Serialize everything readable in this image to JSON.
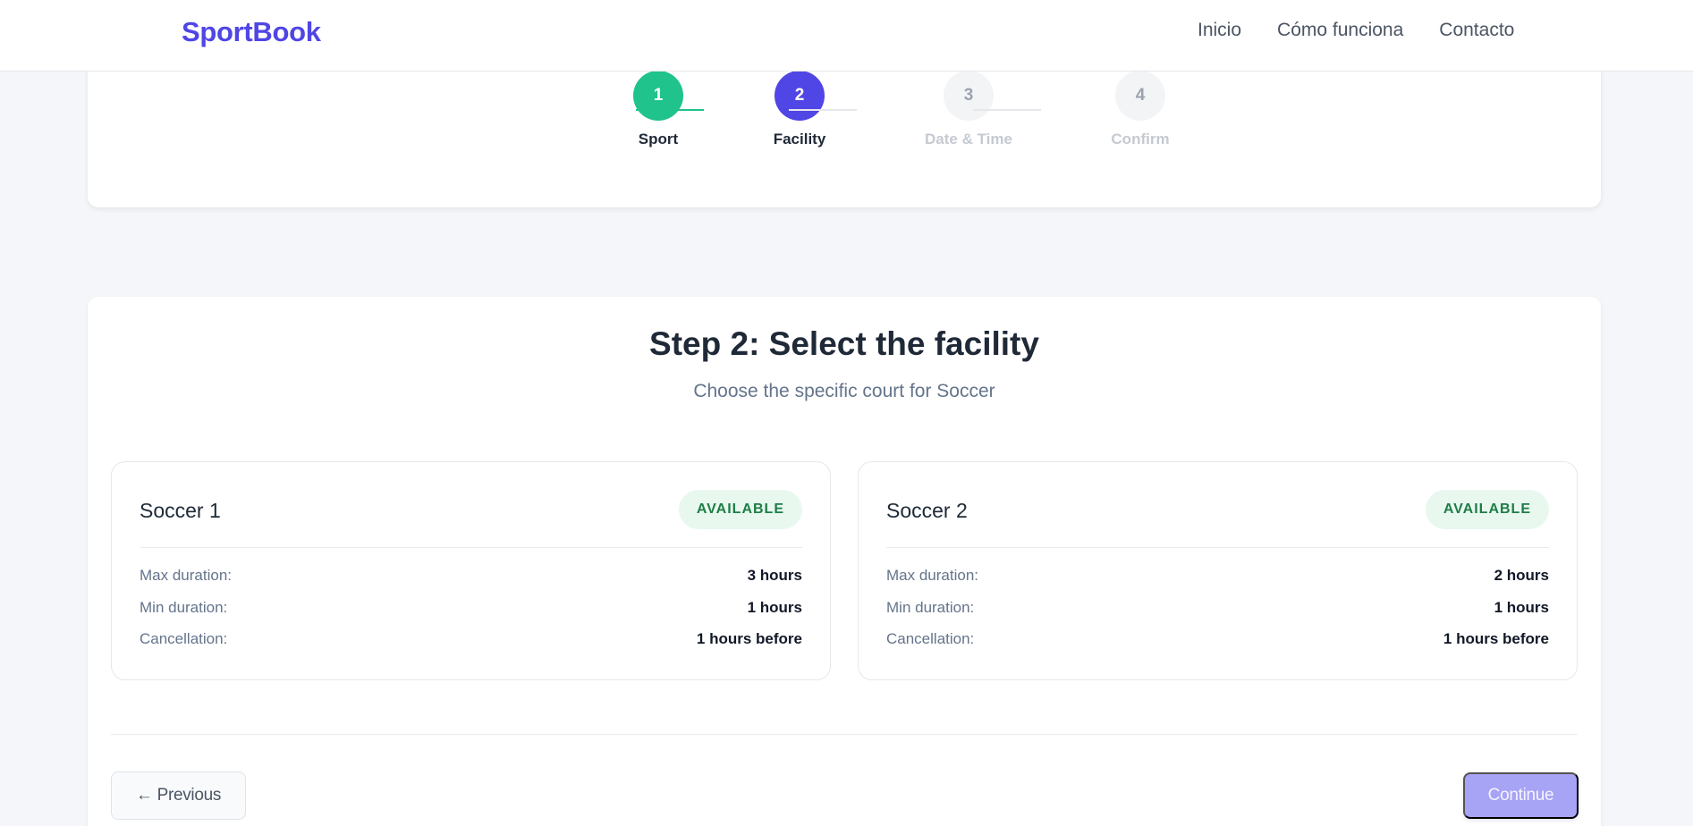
{
  "header": {
    "brand": "SportBook",
    "nav": [
      "Inicio",
      "Cómo funciona",
      "Contacto"
    ]
  },
  "stepper": {
    "steps": [
      {
        "number": "1",
        "label": "Sport",
        "state": "done"
      },
      {
        "number": "2",
        "label": "Facility",
        "state": "active"
      },
      {
        "number": "3",
        "label": "Date & Time",
        "state": "pending"
      },
      {
        "number": "4",
        "label": "Confirm",
        "state": "pending"
      }
    ]
  },
  "main": {
    "title": "Step 2: Select the facility",
    "subtitle": "Choose the specific court for Soccer",
    "facilities": [
      {
        "name": "Soccer 1",
        "status": "AVAILABLE",
        "rows": [
          {
            "label": "Max duration:",
            "value": "3 hours"
          },
          {
            "label": "Min duration:",
            "value": "1 hours"
          },
          {
            "label": "Cancellation:",
            "value": "1 hours before"
          }
        ]
      },
      {
        "name": "Soccer 2",
        "status": "AVAILABLE",
        "rows": [
          {
            "label": "Max duration:",
            "value": "2 hours"
          },
          {
            "label": "Min duration:",
            "value": "1 hours"
          },
          {
            "label": "Cancellation:",
            "value": "1 hours before"
          }
        ]
      }
    ],
    "previous_label": "← Previous",
    "continue_label": "Continue"
  },
  "colors": {
    "brand": "#4f46e5",
    "step_done": "#20c38b",
    "step_active": "#5046e5",
    "available_badge_bg": "#e8f8ef",
    "available_badge_text": "#1e7d46",
    "continue_disabled": "#a7a3f5"
  }
}
